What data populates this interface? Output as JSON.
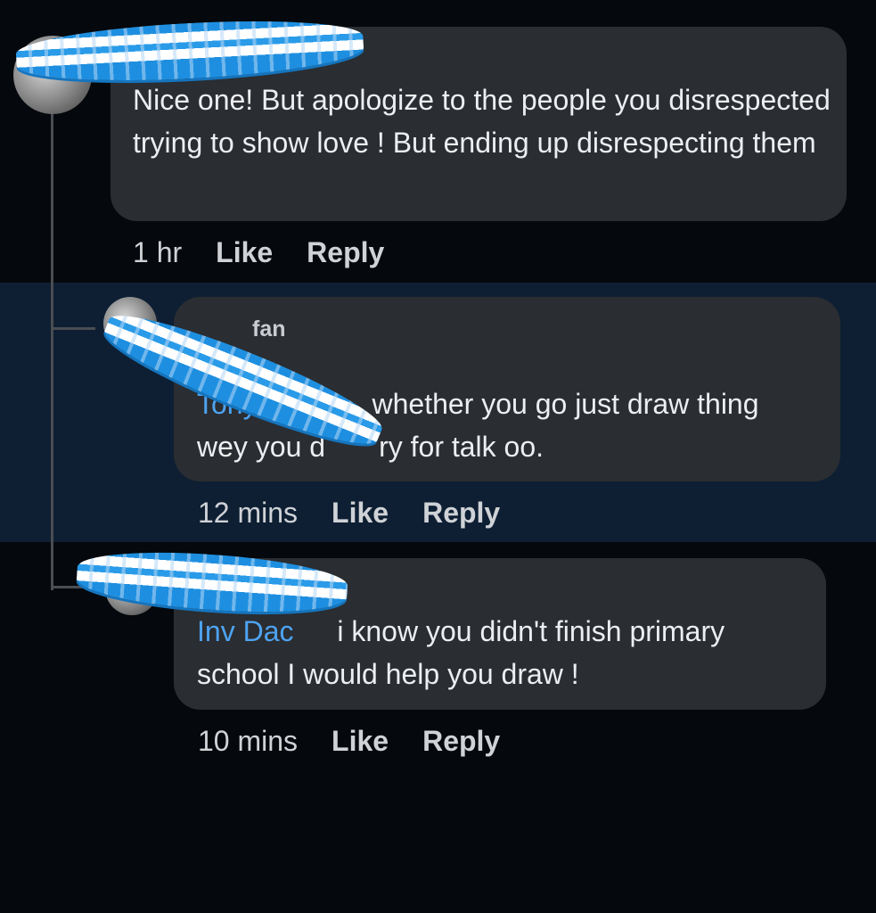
{
  "comments": [
    {
      "author": "",
      "mention": "",
      "text": "Nice one! But apologize to the people you disrespected trying to show love ! But ending up disrespecting them",
      "time": "1 hr",
      "like_label": "Like",
      "reply_label": "Reply"
    },
    {
      "author": "fan",
      "mention": "Tony",
      "text": "whether you go just draw thing wey you de ry for talk oo.",
      "text_line1": "whether you go just draw thing",
      "text_line2_a": "wey you d",
      "text_line2_b": "ry for talk oo.",
      "time": "12 mins",
      "like_label": "Like",
      "reply_label": "Reply"
    },
    {
      "author": "",
      "mention": "Inv Dac",
      "text": "i know you didn't finish primary school I would help you draw !",
      "text_line1": "i know you didn't finish primary",
      "text_line2": "school I would help you draw !",
      "time": "10 mins",
      "like_label": "Like",
      "reply_label": "Reply"
    }
  ],
  "colors": {
    "background": "#05080c",
    "highlight_band": "#0e1f33",
    "bubble": "#2a2d31",
    "mention": "#4ea3f1",
    "sticker_blue": "#1e8fe0"
  }
}
